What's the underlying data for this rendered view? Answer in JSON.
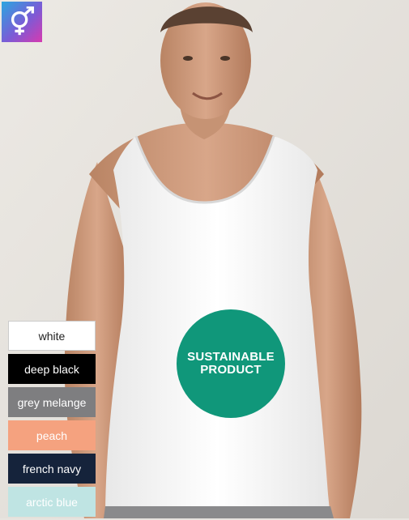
{
  "badge": {
    "icon": "male-female-symbol-icon"
  },
  "colors": [
    {
      "key": "white",
      "label": "white",
      "hex": "#ffffff"
    },
    {
      "key": "deep-black",
      "label": "deep black",
      "hex": "#000000"
    },
    {
      "key": "grey-melange",
      "label": "grey melange",
      "hex": "#7e7e80"
    },
    {
      "key": "peach",
      "label": "peach",
      "hex": "#f5a27f"
    },
    {
      "key": "french-navy",
      "label": "french navy",
      "hex": "#15233b"
    },
    {
      "key": "arctic-blue",
      "label": "arctic blue",
      "hex": "#bfe4e3"
    }
  ],
  "eco": {
    "line1": "SUSTAINABLE",
    "line2": "PRODUCT",
    "color": "#10977a"
  }
}
